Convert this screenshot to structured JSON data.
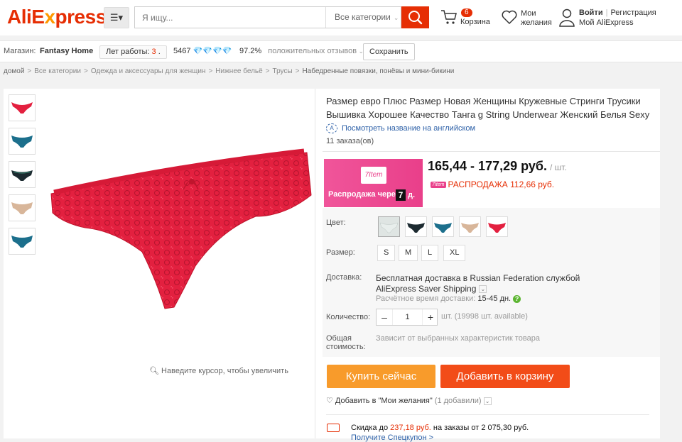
{
  "header": {
    "logo": "AliExpress",
    "search_placeholder": "Я ищу...",
    "category_select": "Все категории",
    "cart_count": "6",
    "cart_label": "Корзина",
    "wish_line1": "Мои",
    "wish_line2": "желания",
    "login": "Войти",
    "register": "Регистрация",
    "my_account": "Мой AliExpress"
  },
  "store": {
    "label": "Магазин:",
    "name": "Fantasy Home",
    "years_label": "Лет работы:",
    "years_value": "3",
    "rating_score": "5467",
    "positive_percent": "97.2%",
    "positive_label": "положительных отзывов",
    "save_button": "Сохранить"
  },
  "breadcrumb": {
    "items": [
      "домой",
      "Все категории",
      "Одежда и аксессуары для женщин",
      "Нижнее бельё",
      "Трусы",
      "Набедренные повязки, понёвы и мини-бикини"
    ]
  },
  "gallery": {
    "zoom_hint": "Наведите курсор, чтобы увеличить"
  },
  "product": {
    "title": "Размер евро Плюс Размер Новая Женщины Кружевные Стринги Трусики Вышивка Хорошее Качество Танга g String Underwear Женский Белья Sexy",
    "translate_link": "Посмотреть название на английском",
    "orders": "11 заказа(ов)",
    "promo_logo": "7Item",
    "promo_text": "Распродажа через",
    "promo_days": "7",
    "promo_days_suffix": "д.",
    "price_range": "165,44 - 177,29 руб.",
    "price_unit": "/ шт.",
    "sale_tag": "7Item",
    "sale_text": "РАСПРОДАЖА 112,66 руб."
  },
  "options": {
    "color_label": "Цвет:",
    "size_label": "Размер:",
    "sizes": [
      "S",
      "M",
      "L",
      "XL"
    ],
    "shipping_label": "Доставка:",
    "shipping_line1": "Бесплатная доставка в Russian Federation службой",
    "shipping_line2": "AliExpress Saver Shipping",
    "delivery_time_label": "Расчётное время доставки:",
    "delivery_time_value": "15-45 дн.",
    "quantity_label": "Количество:",
    "quantity_value": "1",
    "quantity_minus": "–",
    "quantity_plus": "+",
    "quantity_available": "шт. (19998 шт. available)",
    "total_label1": "Общая",
    "total_label2": "стоимость:",
    "total_value": "Зависит от выбранных характеристик товара"
  },
  "actions": {
    "buy_now": "Купить сейчас",
    "add_to_cart": "Добавить в корзину",
    "add_wish": "Добавить в \"Мои желания\"",
    "wish_count": "(1 добавили)",
    "coupon_prefix": "Скидка до",
    "coupon_amount": "237,18 руб.",
    "coupon_suffix": "на заказы от 2 075,30 руб.",
    "get_coupon": "Получите Спецкупон >"
  },
  "colors": {
    "brand": "#e62e04",
    "product": "#e3203f",
    "swatch_black": "#1c2a30",
    "swatch_teal": "#1c6f8c",
    "swatch_nude": "#d8b69a"
  }
}
